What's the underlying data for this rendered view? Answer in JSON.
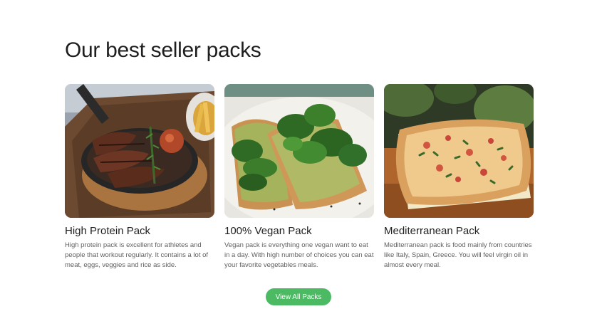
{
  "section": {
    "title": "Our best seller packs"
  },
  "packs": [
    {
      "title": "High Protein Pack",
      "description": "High protein pack is excellent for athletes and people that workout regularly. It contains a lot of meat, eggs, veggies and rice as side.",
      "image": "steak-skillet-photo"
    },
    {
      "title": "100% Vegan Pack",
      "description": "Vegan pack is everything one vegan want to eat in a day. With high number of choices you can eat your favorite vegetables meals.",
      "image": "avocado-spinach-toast-photo"
    },
    {
      "title": "Mediterranean Pack",
      "description": "Mediterranean pack is food mainly from countries like Italy, Spain, Greece. You will feel virgin oil in almost every meal.",
      "image": "flatbread-pizza-photo"
    }
  ],
  "cta": {
    "label": "View All Packs"
  },
  "colors": {
    "accent": "#4cb963",
    "title_text": "#1f1f1f",
    "body_text": "#5f5f5f"
  }
}
